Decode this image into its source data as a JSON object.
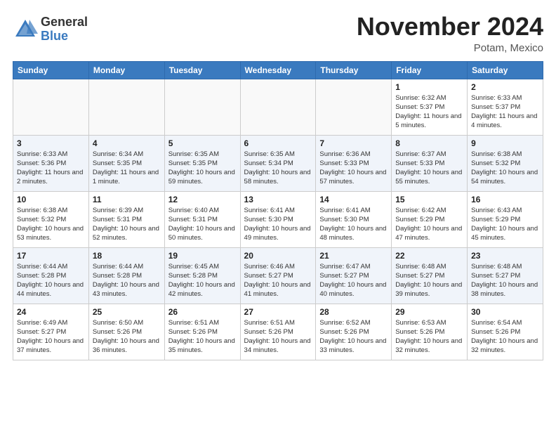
{
  "header": {
    "logo_general": "General",
    "logo_blue": "Blue",
    "month_title": "November 2024",
    "location": "Potam, Mexico"
  },
  "weekdays": [
    "Sunday",
    "Monday",
    "Tuesday",
    "Wednesday",
    "Thursday",
    "Friday",
    "Saturday"
  ],
  "weeks": [
    [
      {
        "day": "",
        "info": ""
      },
      {
        "day": "",
        "info": ""
      },
      {
        "day": "",
        "info": ""
      },
      {
        "day": "",
        "info": ""
      },
      {
        "day": "",
        "info": ""
      },
      {
        "day": "1",
        "info": "Sunrise: 6:32 AM\nSunset: 5:37 PM\nDaylight: 11 hours and 5 minutes."
      },
      {
        "day": "2",
        "info": "Sunrise: 6:33 AM\nSunset: 5:37 PM\nDaylight: 11 hours and 4 minutes."
      }
    ],
    [
      {
        "day": "3",
        "info": "Sunrise: 6:33 AM\nSunset: 5:36 PM\nDaylight: 11 hours and 2 minutes."
      },
      {
        "day": "4",
        "info": "Sunrise: 6:34 AM\nSunset: 5:35 PM\nDaylight: 11 hours and 1 minute."
      },
      {
        "day": "5",
        "info": "Sunrise: 6:35 AM\nSunset: 5:35 PM\nDaylight: 10 hours and 59 minutes."
      },
      {
        "day": "6",
        "info": "Sunrise: 6:35 AM\nSunset: 5:34 PM\nDaylight: 10 hours and 58 minutes."
      },
      {
        "day": "7",
        "info": "Sunrise: 6:36 AM\nSunset: 5:33 PM\nDaylight: 10 hours and 57 minutes."
      },
      {
        "day": "8",
        "info": "Sunrise: 6:37 AM\nSunset: 5:33 PM\nDaylight: 10 hours and 55 minutes."
      },
      {
        "day": "9",
        "info": "Sunrise: 6:38 AM\nSunset: 5:32 PM\nDaylight: 10 hours and 54 minutes."
      }
    ],
    [
      {
        "day": "10",
        "info": "Sunrise: 6:38 AM\nSunset: 5:32 PM\nDaylight: 10 hours and 53 minutes."
      },
      {
        "day": "11",
        "info": "Sunrise: 6:39 AM\nSunset: 5:31 PM\nDaylight: 10 hours and 52 minutes."
      },
      {
        "day": "12",
        "info": "Sunrise: 6:40 AM\nSunset: 5:31 PM\nDaylight: 10 hours and 50 minutes."
      },
      {
        "day": "13",
        "info": "Sunrise: 6:41 AM\nSunset: 5:30 PM\nDaylight: 10 hours and 49 minutes."
      },
      {
        "day": "14",
        "info": "Sunrise: 6:41 AM\nSunset: 5:30 PM\nDaylight: 10 hours and 48 minutes."
      },
      {
        "day": "15",
        "info": "Sunrise: 6:42 AM\nSunset: 5:29 PM\nDaylight: 10 hours and 47 minutes."
      },
      {
        "day": "16",
        "info": "Sunrise: 6:43 AM\nSunset: 5:29 PM\nDaylight: 10 hours and 45 minutes."
      }
    ],
    [
      {
        "day": "17",
        "info": "Sunrise: 6:44 AM\nSunset: 5:28 PM\nDaylight: 10 hours and 44 minutes."
      },
      {
        "day": "18",
        "info": "Sunrise: 6:44 AM\nSunset: 5:28 PM\nDaylight: 10 hours and 43 minutes."
      },
      {
        "day": "19",
        "info": "Sunrise: 6:45 AM\nSunset: 5:28 PM\nDaylight: 10 hours and 42 minutes."
      },
      {
        "day": "20",
        "info": "Sunrise: 6:46 AM\nSunset: 5:27 PM\nDaylight: 10 hours and 41 minutes."
      },
      {
        "day": "21",
        "info": "Sunrise: 6:47 AM\nSunset: 5:27 PM\nDaylight: 10 hours and 40 minutes."
      },
      {
        "day": "22",
        "info": "Sunrise: 6:48 AM\nSunset: 5:27 PM\nDaylight: 10 hours and 39 minutes."
      },
      {
        "day": "23",
        "info": "Sunrise: 6:48 AM\nSunset: 5:27 PM\nDaylight: 10 hours and 38 minutes."
      }
    ],
    [
      {
        "day": "24",
        "info": "Sunrise: 6:49 AM\nSunset: 5:27 PM\nDaylight: 10 hours and 37 minutes."
      },
      {
        "day": "25",
        "info": "Sunrise: 6:50 AM\nSunset: 5:26 PM\nDaylight: 10 hours and 36 minutes."
      },
      {
        "day": "26",
        "info": "Sunrise: 6:51 AM\nSunset: 5:26 PM\nDaylight: 10 hours and 35 minutes."
      },
      {
        "day": "27",
        "info": "Sunrise: 6:51 AM\nSunset: 5:26 PM\nDaylight: 10 hours and 34 minutes."
      },
      {
        "day": "28",
        "info": "Sunrise: 6:52 AM\nSunset: 5:26 PM\nDaylight: 10 hours and 33 minutes."
      },
      {
        "day": "29",
        "info": "Sunrise: 6:53 AM\nSunset: 5:26 PM\nDaylight: 10 hours and 32 minutes."
      },
      {
        "day": "30",
        "info": "Sunrise: 6:54 AM\nSunset: 5:26 PM\nDaylight: 10 hours and 32 minutes."
      }
    ]
  ]
}
